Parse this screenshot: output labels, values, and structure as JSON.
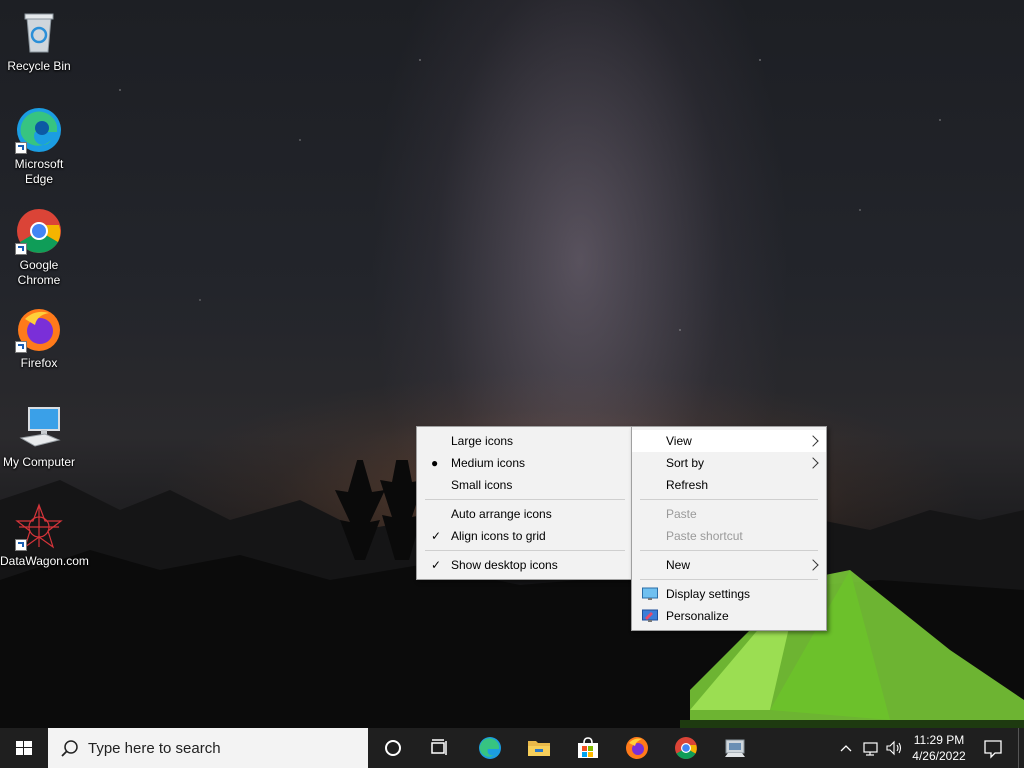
{
  "desktop": {
    "icons": [
      {
        "label": "Recycle Bin",
        "icon": "recycle-bin-icon"
      },
      {
        "label": "Microsoft Edge",
        "icon": "edge-icon"
      },
      {
        "label": "Google Chrome",
        "icon": "chrome-icon"
      },
      {
        "label": "Firefox",
        "icon": "firefox-icon"
      },
      {
        "label": "My Computer",
        "icon": "computer-icon"
      },
      {
        "label": "DataWagon.com",
        "icon": "datawagon-icon"
      }
    ]
  },
  "context_menu": {
    "items": [
      {
        "label": "View",
        "submenu": true,
        "highlighted": true
      },
      {
        "label": "Sort by",
        "submenu": true
      },
      {
        "label": "Refresh"
      },
      {
        "label": "Paste",
        "disabled": true
      },
      {
        "label": "Paste shortcut",
        "disabled": true
      },
      {
        "label": "New",
        "submenu": true
      },
      {
        "label": "Display settings",
        "icon": "display-settings-icon"
      },
      {
        "label": "Personalize",
        "icon": "personalize-icon"
      }
    ]
  },
  "view_submenu": {
    "items": [
      {
        "label": "Large icons"
      },
      {
        "label": "Medium icons",
        "selected": true,
        "mark": "●"
      },
      {
        "label": "Small icons"
      },
      {
        "label": "Auto arrange icons"
      },
      {
        "label": "Align icons to grid",
        "checked": true,
        "mark": "✓"
      },
      {
        "label": "Show desktop icons",
        "checked": true,
        "mark": "✓"
      }
    ]
  },
  "taskbar": {
    "search_placeholder": "Type here to search",
    "pinned": [
      "cortana-icon",
      "task-view-icon",
      "edge-icon",
      "file-explorer-icon",
      "store-icon",
      "firefox-icon",
      "chrome-icon",
      "app-icon"
    ],
    "tray": [
      "chevron-up-icon",
      "network-icon",
      "volume-icon"
    ],
    "time": "11:29 PM",
    "date": "4/26/2022"
  },
  "colors": {
    "taskbar": "#1f1f1f",
    "menu_bg": "#f2f2f2",
    "menu_hover": "#ffffff",
    "disabled_text": "#9a9a9a",
    "accent": "#0078d4"
  }
}
